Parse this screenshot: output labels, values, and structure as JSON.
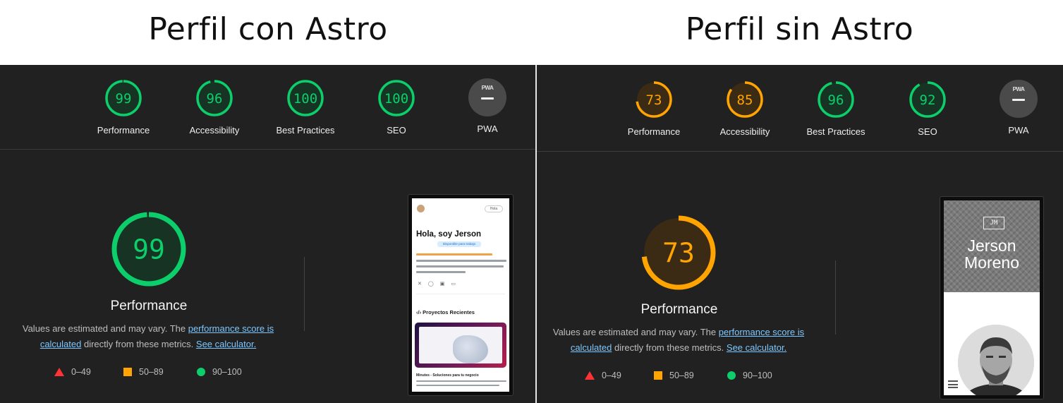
{
  "titles": {
    "left": "Perfil con Astro",
    "right": "Perfil sin Astro"
  },
  "colors": {
    "pass": "#0cce6b",
    "average": "#ffa400",
    "fail": "#ff3333",
    "panel_bg": "#212121",
    "link": "#7cc7ff"
  },
  "left": {
    "gauges": [
      {
        "label": "Performance",
        "score": "99",
        "status": "pass"
      },
      {
        "label": "Accessibility",
        "score": "96",
        "status": "pass"
      },
      {
        "label": "Best Practices",
        "score": "100",
        "status": "pass"
      },
      {
        "label": "SEO",
        "score": "100",
        "status": "pass"
      }
    ],
    "pwa": {
      "label": "PWA",
      "badge": "PWA"
    },
    "main": {
      "score": "99",
      "title": "Performance",
      "desc_text1": "Values are estimated and may vary. The ",
      "desc_link1": "performance score is calculated",
      "desc_text2": " directly from these metrics. ",
      "desc_link2": "See calculator."
    },
    "legend": {
      "fail": "0–49",
      "average": "50–89",
      "pass": "90–100"
    },
    "thumbnail": {
      "nav_pill": "Hola",
      "heading": "Hola, soy Jerson",
      "badge": "Disponible para trabajo",
      "projects_title": "Proyectos Recientes",
      "project_caption": "Minutes - Soluciones para tu negocio"
    }
  },
  "right": {
    "gauges": [
      {
        "label": "Performance",
        "score": "73",
        "status": "average"
      },
      {
        "label": "Accessibility",
        "score": "85",
        "status": "average"
      },
      {
        "label": "Best Practices",
        "score": "96",
        "status": "pass"
      },
      {
        "label": "SEO",
        "score": "92",
        "status": "pass"
      }
    ],
    "pwa": {
      "label": "PWA",
      "badge": "PWA"
    },
    "main": {
      "score": "73",
      "title": "Performance",
      "desc_text1": "Values are estimated and may vary. The ",
      "desc_link1": "performance score is calculated",
      "desc_text2": " directly from these metrics. ",
      "desc_link2": "See calculator."
    },
    "legend": {
      "fail": "0–49",
      "average": "50–89",
      "pass": "90–100"
    },
    "thumbnail": {
      "logo": "JM",
      "name_line1": "Jerson",
      "name_line2": "Moreno"
    }
  }
}
